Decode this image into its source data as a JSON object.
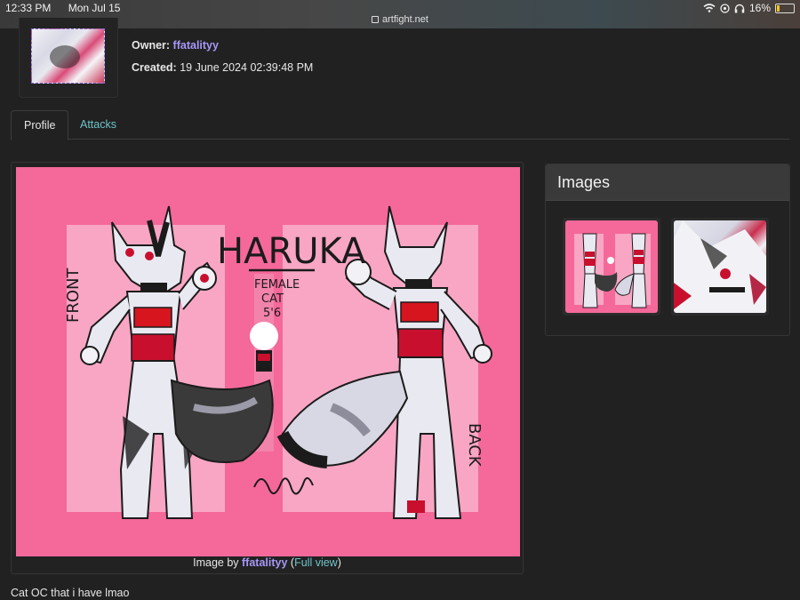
{
  "status_bar": {
    "time": "12:33 PM",
    "date": "Mon Jul 15",
    "url": "artfight.net",
    "battery": "16%"
  },
  "character": {
    "owner_label": "Owner:",
    "owner": "ffatalityy",
    "created_label": "Created:",
    "created": "19 June 2024 02:39:48 PM"
  },
  "tabs": [
    {
      "label": "Profile",
      "active": true
    },
    {
      "label": "Attacks",
      "active": false
    }
  ],
  "main_image": {
    "sheet_title": "HARUKA",
    "sheet_subtitle_lines": [
      "FEMALE",
      "CAT",
      "5'6"
    ],
    "sheet_front_label": "FRONT",
    "sheet_back_label": "BACK",
    "caption_prefix": "Image by",
    "caption_owner": "ffatalityy",
    "caption_open": "(",
    "caption_link": "Full view",
    "caption_close": ")"
  },
  "description": "Cat OC that i have lmao",
  "images_panel": {
    "title": "Images",
    "thumbnails": [
      {
        "name": "reference sheet thumbnail"
      },
      {
        "name": "headshot thumbnail"
      }
    ]
  },
  "colors": {
    "background": "#212121",
    "owner_link": "#a597f5",
    "tab_link": "#6ec3c9",
    "sheet_pink": "#f5689a"
  }
}
